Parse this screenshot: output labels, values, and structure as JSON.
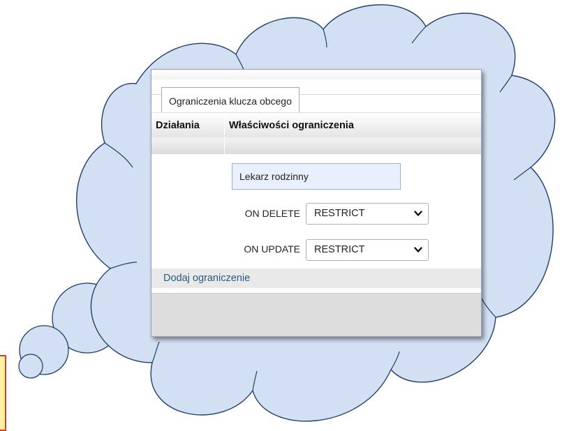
{
  "colors": {
    "cloud_fill": "#d3e0f3",
    "cloud_outline": "#1f3f6b",
    "link": "#235a81",
    "input_background": "#e7f0fc"
  },
  "panel": {
    "fieldset_legend": "Ograniczenia klucza obcego",
    "columns": {
      "actions": "Działania",
      "properties": "Właściwości ograniczenia"
    },
    "constraint_name": {
      "value": "Lekarz rodzinny"
    },
    "on_delete": {
      "label": "ON DELETE",
      "selected": "RESTRICT"
    },
    "on_update": {
      "label": "ON UPDATE",
      "selected": "RESTRICT"
    },
    "add_constraint_link": "Dodaj ograniczenie"
  },
  "icons": {
    "select_arrow": "chevron-down-icon"
  }
}
